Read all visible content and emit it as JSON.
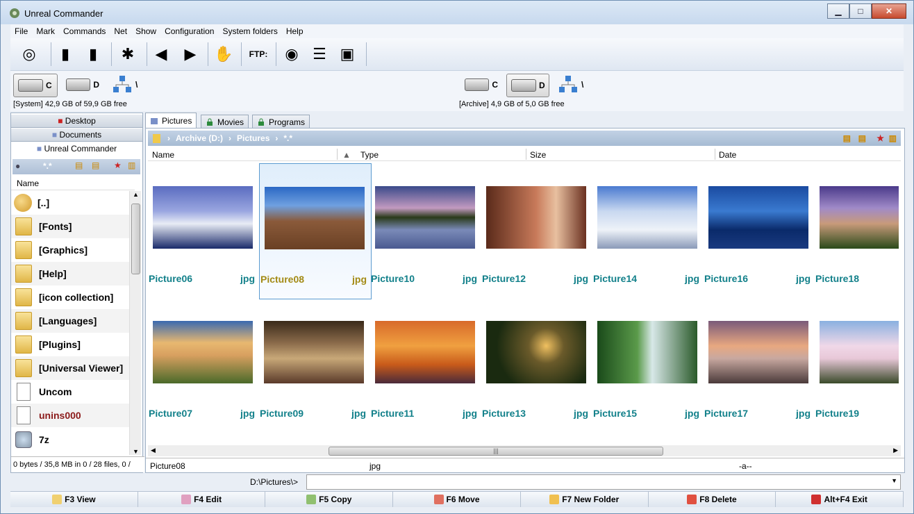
{
  "window": {
    "title": "Unreal Commander"
  },
  "menu": [
    "File",
    "Mark",
    "Commands",
    "Net",
    "Show",
    "Configuration",
    "System folders",
    "Help"
  ],
  "toolbar": {
    "ftp_label": "FTP:"
  },
  "drives_left": {
    "c": "C",
    "d": "D",
    "net": "\\",
    "info": "[System]  42,9 GB of  59,9 GB free"
  },
  "drives_right": {
    "c": "C",
    "d": "D",
    "net": "\\",
    "info": "[Archive]  4,9 GB of  5,0 GB free"
  },
  "left_panel": {
    "tabs": [
      "Desktop",
      "Documents",
      "Unreal Commander"
    ],
    "path": "*.*",
    "column_name": "Name",
    "files": [
      {
        "name": "[..]",
        "type": "up"
      },
      {
        "name": "[Fonts]",
        "type": "folder"
      },
      {
        "name": "[Graphics]",
        "type": "folder"
      },
      {
        "name": "[Help]",
        "type": "folder"
      },
      {
        "name": "[icon collection]",
        "type": "folder"
      },
      {
        "name": "[Languages]",
        "type": "folder"
      },
      {
        "name": "[Plugins]",
        "type": "folder"
      },
      {
        "name": "[Universal Viewer]",
        "type": "folder"
      },
      {
        "name": "Uncom",
        "type": "file"
      },
      {
        "name": "unins000",
        "type": "file"
      },
      {
        "name": "7z",
        "type": "gear"
      }
    ],
    "status": "0 bytes / 35,8 MB in 0 / 28 files, 0 /"
  },
  "right_panel": {
    "tabs": [
      "Pictures",
      "Movies",
      "Programs"
    ],
    "path": {
      "drive": "Archive (D:)",
      "folder": "Pictures",
      "mask": "*.*"
    },
    "columns": [
      "Name",
      "Type",
      "Size",
      "Date"
    ],
    "thumbs_row1": [
      {
        "name": "Picture06",
        "ext": "jpg"
      },
      {
        "name": "Picture08",
        "ext": "jpg"
      },
      {
        "name": "Picture10",
        "ext": "jpg"
      },
      {
        "name": "Picture12",
        "ext": "jpg"
      },
      {
        "name": "Picture14",
        "ext": "jpg"
      },
      {
        "name": "Picture16",
        "ext": "jpg"
      },
      {
        "name": "Picture18",
        "ext": ""
      }
    ],
    "thumbs_row2": [
      {
        "name": "Picture07",
        "ext": "jpg"
      },
      {
        "name": "Picture09",
        "ext": "jpg"
      },
      {
        "name": "Picture11",
        "ext": "jpg"
      },
      {
        "name": "Picture13",
        "ext": "jpg"
      },
      {
        "name": "Picture15",
        "ext": "jpg"
      },
      {
        "name": "Picture17",
        "ext": "jpg"
      },
      {
        "name": "Picture19",
        "ext": ""
      }
    ],
    "status": {
      "name": "Picture08",
      "type": "jpg",
      "attr": "-a--"
    }
  },
  "cmdline": {
    "path": "D:\\Pictures\\>"
  },
  "fkeys": [
    "F3 View",
    "F4 Edit",
    "F5 Copy",
    "F6 Move",
    "F7 New Folder",
    "F8 Delete",
    "Alt+F4 Exit"
  ]
}
